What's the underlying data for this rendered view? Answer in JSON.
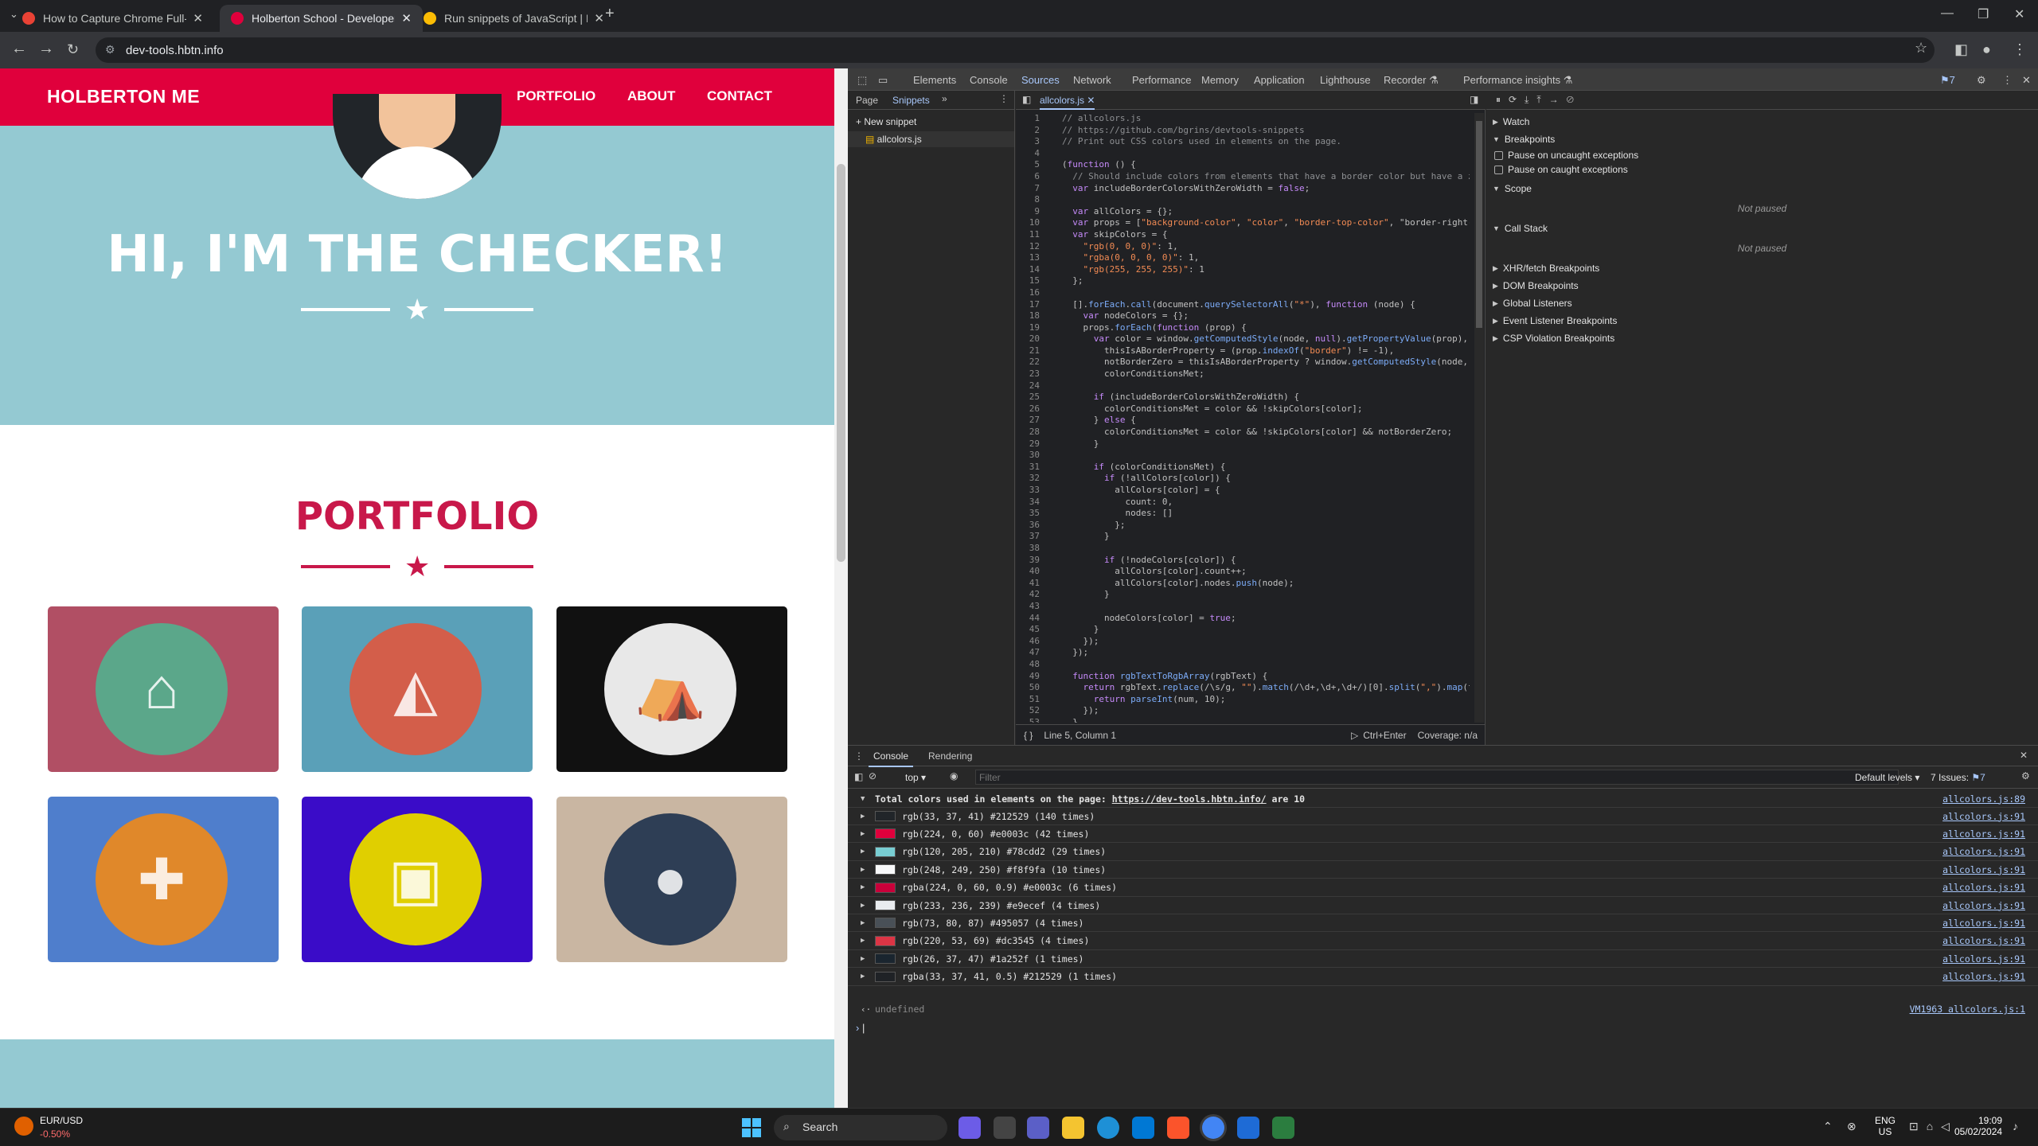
{
  "browser": {
    "tabs": [
      {
        "title": "How to Capture Chrome Full-P",
        "active": false,
        "favicon_color": "#e94235"
      },
      {
        "title": "Holberton School - Developer",
        "active": true,
        "favicon_color": "#e0003c"
      },
      {
        "title": "Run snippets of JavaScript | D",
        "active": false,
        "favicon_color": "#fbbc04"
      }
    ],
    "new_tab_icon": "+",
    "url": "dev-tools.hbtn.info",
    "window_controls": {
      "minimize": "—",
      "maximize": "❐",
      "close": "✕"
    }
  },
  "site": {
    "logo": "HOLBERTON ME",
    "nav": [
      "PORTFOLIO",
      "ABOUT",
      "CONTACT"
    ],
    "hero_title": "HI, I'M THE CHECKER!",
    "portfolio_title": "PORTFOLIO",
    "cards": [
      {
        "name": "cabin",
        "bg": "#b14f64",
        "circle": "#5ba78a",
        "icon": "cabin-icon"
      },
      {
        "name": "cake",
        "bg": "#5aa0b8",
        "circle": "#d35e4a",
        "icon": "cake-icon"
      },
      {
        "name": "circus",
        "bg": "#111111",
        "circle": "#e8e8e8",
        "icon": "circus-tent-icon"
      },
      {
        "name": "game",
        "bg": "#4f7ecc",
        "circle": "#e0882a",
        "icon": "gamepad-icon"
      },
      {
        "name": "safe",
        "bg": "#3a0cc8",
        "circle": "#e0cf00",
        "icon": "safe-icon"
      },
      {
        "name": "submarine",
        "bg": "#c9b6a2",
        "circle": "#2e3e55",
        "icon": "submarine-icon"
      }
    ],
    "colors": {
      "header": "#e0003c",
      "hero": "#94c9d2",
      "accent": "#c8184a"
    }
  },
  "devtools": {
    "panels": [
      "Elements",
      "Console",
      "Sources",
      "Network",
      "Performance",
      "Memory",
      "Application",
      "Lighthouse",
      "Recorder ⚗",
      "Performance insights ⚗"
    ],
    "selected_panel": "Sources",
    "issues_count": "7",
    "navigator_tabs": [
      "Page",
      "Snippets"
    ],
    "new_snippet": "New snippet",
    "snippet_file": "allcolors.js",
    "editor_tab": "allcolors.js",
    "status_position": "Line 5, Column 1",
    "run_hint": "Ctrl+Enter",
    "coverage": "Coverage: n/a",
    "debugger_sections": [
      {
        "label": "Watch",
        "open": false
      },
      {
        "label": "Breakpoints",
        "open": true
      },
      {
        "label": "Scope",
        "open": true
      },
      {
        "label": "Call Stack",
        "open": true
      },
      {
        "label": "XHR/fetch Breakpoints",
        "open": false
      },
      {
        "label": "DOM Breakpoints",
        "open": false
      },
      {
        "label": "Global Listeners",
        "open": false
      },
      {
        "label": "Event Listener Breakpoints",
        "open": false
      },
      {
        "label": "CSP Violation Breakpoints",
        "open": false
      }
    ],
    "pause_uncaught": "Pause on uncaught exceptions",
    "pause_caught": "Pause on caught exceptions",
    "not_paused": "Not paused",
    "code_lines": [
      "// allcolors.js",
      "// https://github.com/bgrins/devtools-snippets",
      "// Print out CSS colors used in elements on the page.",
      "",
      "(function () {",
      "  // Should include colors from elements that have a border color but have a z",
      "  var includeBorderColorsWithZeroWidth = false;",
      "",
      "  var allColors = {};",
      "  var props = [\"background-color\", \"color\", \"border-top-color\", \"border-right-",
      "  var skipColors = {",
      "    \"rgb(0, 0, 0)\": 1,",
      "    \"rgba(0, 0, 0, 0)\": 1,",
      "    \"rgb(255, 255, 255)\": 1",
      "  };",
      "",
      "  [].forEach.call(document.querySelectorAll(\"*\"), function (node) {",
      "    var nodeColors = {};",
      "    props.forEach(function (prop) {",
      "      var color = window.getComputedStyle(node, null).getPropertyValue(prop),",
      "        thisIsABorderProperty = (prop.indexOf(\"border\") != -1),",
      "        notBorderZero = thisIsABorderProperty ? window.getComputedStyle(node,",
      "        colorConditionsMet;",
      "",
      "      if (includeBorderColorsWithZeroWidth) {",
      "        colorConditionsMet = color && !skipColors[color];",
      "      } else {",
      "        colorConditionsMet = color && !skipColors[color] && notBorderZero;",
      "      }",
      "",
      "      if (colorConditionsMet) {",
      "        if (!allColors[color]) {",
      "          allColors[color] = {",
      "            count: 0,",
      "            nodes: []",
      "          };",
      "        }",
      "",
      "        if (!nodeColors[color]) {",
      "          allColors[color].count++;",
      "          allColors[color].nodes.push(node);",
      "        }",
      "",
      "        nodeColors[color] = true;",
      "      }",
      "    });",
      "  });",
      "",
      "  function rgbTextToRgbArray(rgbText) {",
      "    return rgbText.replace(/\\s/g, \"\").match(/\\d+,\\d+,\\d+/)[0].split(\",\").map(f",
      "      return parseInt(num, 10);",
      "    });",
      "  }"
    ],
    "drawer_tabs": [
      "Console",
      "Rendering"
    ],
    "context": "top",
    "filter_placeholder": "Filter",
    "levels": "Default levels ▾",
    "issues_label": "7 Issues:",
    "summary_text": "Total colors used in elements on the page:",
    "summary_link": "https://dev-tools.hbtn.info/",
    "summary_suffix": "are 10",
    "summary_src": "allcolors.js:89",
    "color_rows": [
      {
        "text": "rgb(33, 37, 41) #212529 (140 times)",
        "swatch": "#212529",
        "src": "allcolors.js:91"
      },
      {
        "text": "rgb(224, 0, 60) #e0003c (42 times)",
        "swatch": "#e0003c",
        "src": "allcolors.js:91"
      },
      {
        "text": "rgb(120, 205, 210) #78cdd2 (29 times)",
        "swatch": "#78cdd2",
        "src": "allcolors.js:91"
      },
      {
        "text": "rgb(248, 249, 250) #f8f9fa (10 times)",
        "swatch": "#f8f9fa",
        "src": "allcolors.js:91"
      },
      {
        "text": "rgba(224, 0, 60, 0.9) #e0003c (6 times)",
        "swatch": "#c9003a",
        "src": "allcolors.js:91"
      },
      {
        "text": "rgb(233, 236, 239) #e9ecef (4 times)",
        "swatch": "#e9ecef",
        "src": "allcolors.js:91"
      },
      {
        "text": "rgb(73, 80, 87) #495057 (4 times)",
        "swatch": "#495057",
        "src": "allcolors.js:91"
      },
      {
        "text": "rgb(220, 53, 69) #dc3545 (4 times)",
        "swatch": "#dc3545",
        "src": "allcolors.js:91"
      },
      {
        "text": "rgb(26, 37, 47) #1a252f (1 times)",
        "swatch": "#1a252f",
        "src": "allcolors.js:91"
      },
      {
        "text": "rgba(33, 37, 41, 0.5) #212529 (1 times)",
        "swatch": "#1f2226",
        "src": "allcolors.js:91"
      }
    ],
    "undefined_text": "undefined",
    "undefined_src": "VM1963 allcolors.js:1"
  },
  "taskbar": {
    "ticker": "EUR/USD",
    "ticker_change": "-0.50%",
    "search": "Search",
    "lang": "ENG",
    "region": "US",
    "time": "19:09",
    "date": "05/02/2024"
  }
}
